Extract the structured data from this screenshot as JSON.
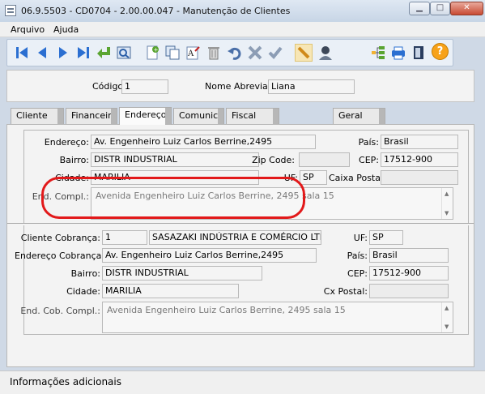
{
  "window": {
    "title": "06.9.5503 - CD0704 - 2.00.00.047 - Manutenção de Clientes"
  },
  "menu": [
    {
      "label": "Arquivo"
    },
    {
      "label": "Ajuda"
    }
  ],
  "toolbar": {
    "icons": [
      "first-icon",
      "prev-icon",
      "next-icon",
      "last-icon",
      "return-icon",
      "search-icon",
      "add-icon",
      "copy-icon",
      "edit-icon",
      "delete-icon",
      "undo-icon",
      "cancel-icon",
      "confirm-icon",
      "pencil-icon",
      "user-icon",
      "tree-icon",
      "print-icon",
      "exit-icon",
      "help-icon"
    ],
    "help_label": "?"
  },
  "header": {
    "codigo_label": "Código:",
    "codigo_value": "1",
    "nome_label": "Nome Abreviado:",
    "nome_value": "Liana"
  },
  "tabs": [
    {
      "label": "Cliente"
    },
    {
      "label": "Financeiro"
    },
    {
      "label": "Endereço",
      "active": true
    },
    {
      "label": "Comunicaç"
    },
    {
      "label": "Fiscal"
    },
    {
      "label": "Geral"
    }
  ],
  "endereco": {
    "endereco_label": "Endereço:",
    "endereco_value": "Av. Engenheiro Luiz Carlos Berrine,2495",
    "pais_label": "País:",
    "pais_value": "Brasil",
    "bairro_label": "Bairro:",
    "bairro_value": "DISTR INDUSTRIAL",
    "zip_label": "Zip Code:",
    "zip_value": "",
    "cep_label": "CEP:",
    "cep_value": "17512-900",
    "cidade_label": "Cidade:",
    "cidade_value": "MARILIA",
    "uf_label": "UF:",
    "uf_value": "SP",
    "caixa_label": "Caixa Postal:",
    "caixa_value": "",
    "compl_label": "End. Compl.:",
    "compl_value": "Avenida Engenheiro Luiz Carlos Berrine, 2495 sala 15"
  },
  "cobranca": {
    "cliente_label": "Cliente Cobrança:",
    "cliente_code": "1",
    "cliente_name": "SASAZAKI INDÚSTRIA E COMÉRCIO LTDA AÇÃ",
    "uf_label": "UF:",
    "uf_value": "SP",
    "endereco_label": "Endereço Cobrança:",
    "endereco_value": "Av. Engenheiro Luiz Carlos Berrine,2495",
    "pais_label": "País:",
    "pais_value": "Brasil",
    "bairro_label": "Bairro:",
    "bairro_value": "DISTR INDUSTRIAL",
    "cep_label": "CEP:",
    "cep_value": "17512-900",
    "cidade_label": "Cidade:",
    "cidade_value": "MARILIA",
    "cx_label": "Cx Postal:",
    "cx_value": "",
    "compl_label": "End. Cob. Compl.:",
    "compl_value": "Avenida Engenheiro Luiz Carlos Berrine, 2495 sala 15"
  },
  "status": {
    "text": "Informações adicionais"
  },
  "colors": {
    "highlight": "#e2191a",
    "toolbar_blue": "#2b6fd1",
    "help_orange": "#f7a21a"
  }
}
